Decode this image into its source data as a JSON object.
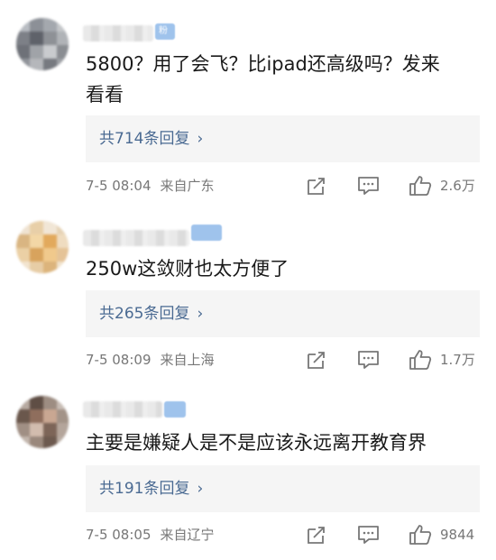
{
  "comments": [
    {
      "user_badge": "粉",
      "text_line1": "5800？用了会飞？比ipad还高级吗？发来",
      "text_line2": "看看",
      "replies": "共714条回复",
      "date": "7-5 08:04",
      "location": "来自广东",
      "likes": "2.6万"
    },
    {
      "user_badge": "",
      "text_line1": "250w这敛财也太方便了",
      "text_line2": "",
      "replies": "共265条回复",
      "date": "7-5 08:09",
      "location": "来自上海",
      "likes": "1.7万"
    },
    {
      "user_badge": "",
      "text_line1": "主要是嫌疑人是不是应该永远离开教育界",
      "text_line2": "",
      "replies": "共191条回复",
      "date": "7-5 08:05",
      "location": "来自辽宁",
      "likes": "9844"
    }
  ],
  "icons": {
    "share": "share-icon",
    "comment": "comment-icon",
    "like": "thumbs-up-icon",
    "chevron": "chevron-right-icon"
  },
  "colors": {
    "link": "#4a6a92",
    "meta": "#777777",
    "reply_bg": "#f5f5f5"
  }
}
